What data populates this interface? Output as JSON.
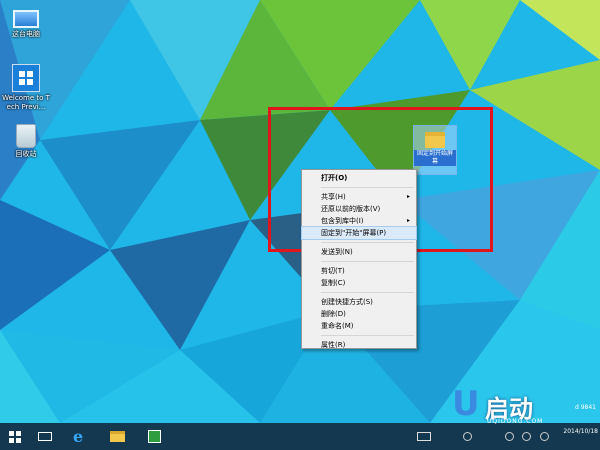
{
  "desktop": {
    "icons": [
      {
        "label": "这台电脑"
      },
      {
        "label": "Welcome to Tech Previ..."
      },
      {
        "label": "回收站"
      }
    ],
    "folder": {
      "label": "固定到开始屏幕"
    }
  },
  "context_menu": {
    "items": [
      {
        "label": "打开(O)",
        "bold": true
      },
      {
        "label": "共享(H)",
        "submenu": true
      },
      {
        "label": "还原以前的版本(V)"
      },
      {
        "label": "包含到库中(I)",
        "submenu": true
      },
      {
        "label": "固定到\"开始\"屏幕(P)",
        "highlighted": true
      },
      {
        "label": "发送到(N)"
      },
      {
        "label": "剪切(T)"
      },
      {
        "label": "复制(C)"
      },
      {
        "label": "创建快捷方式(S)"
      },
      {
        "label": "删除(D)"
      },
      {
        "label": "重命名(M)"
      },
      {
        "label": "属性(R)"
      }
    ],
    "submenu_arrow": "▸"
  },
  "taskbar": {
    "clock_time": "",
    "clock_date": "2014/10/18"
  },
  "watermark": {
    "logo": "U",
    "name": "启动",
    "url": "UQIDONG.COM",
    "build": "d 9841"
  },
  "colors": {
    "highlight_frame": "#e0161c",
    "menu_hover": "#dbeaf9"
  }
}
